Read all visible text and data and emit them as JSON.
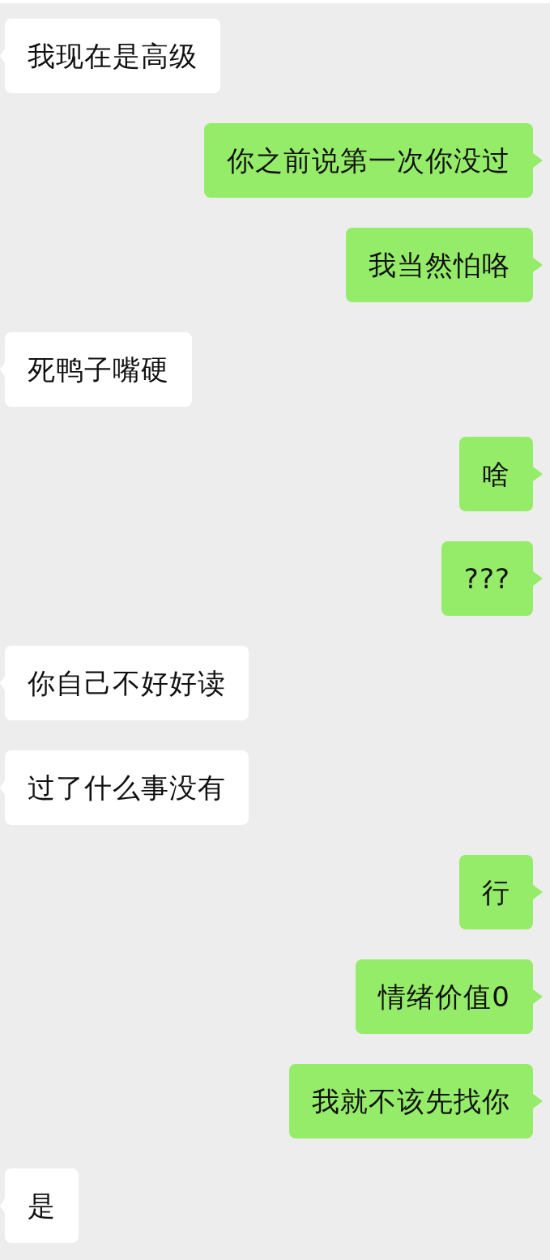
{
  "messages": [
    {
      "kind": "received",
      "text": "我现在是高级"
    },
    {
      "kind": "sent",
      "text": "你之前说第一次你没过"
    },
    {
      "kind": "sent",
      "text": "我当然怕咯"
    },
    {
      "kind": "received",
      "text": "死鸭子嘴硬"
    },
    {
      "kind": "sent",
      "text": "啥"
    },
    {
      "kind": "sent",
      "text": "???"
    },
    {
      "kind": "received",
      "text": "你自己不好好读"
    },
    {
      "kind": "received",
      "text": "过了什么事没有"
    },
    {
      "kind": "sent",
      "text": "行"
    },
    {
      "kind": "sent",
      "text": "情绪价值0"
    },
    {
      "kind": "sent",
      "text": "我就不该先找你"
    },
    {
      "kind": "received",
      "text": "是"
    }
  ]
}
